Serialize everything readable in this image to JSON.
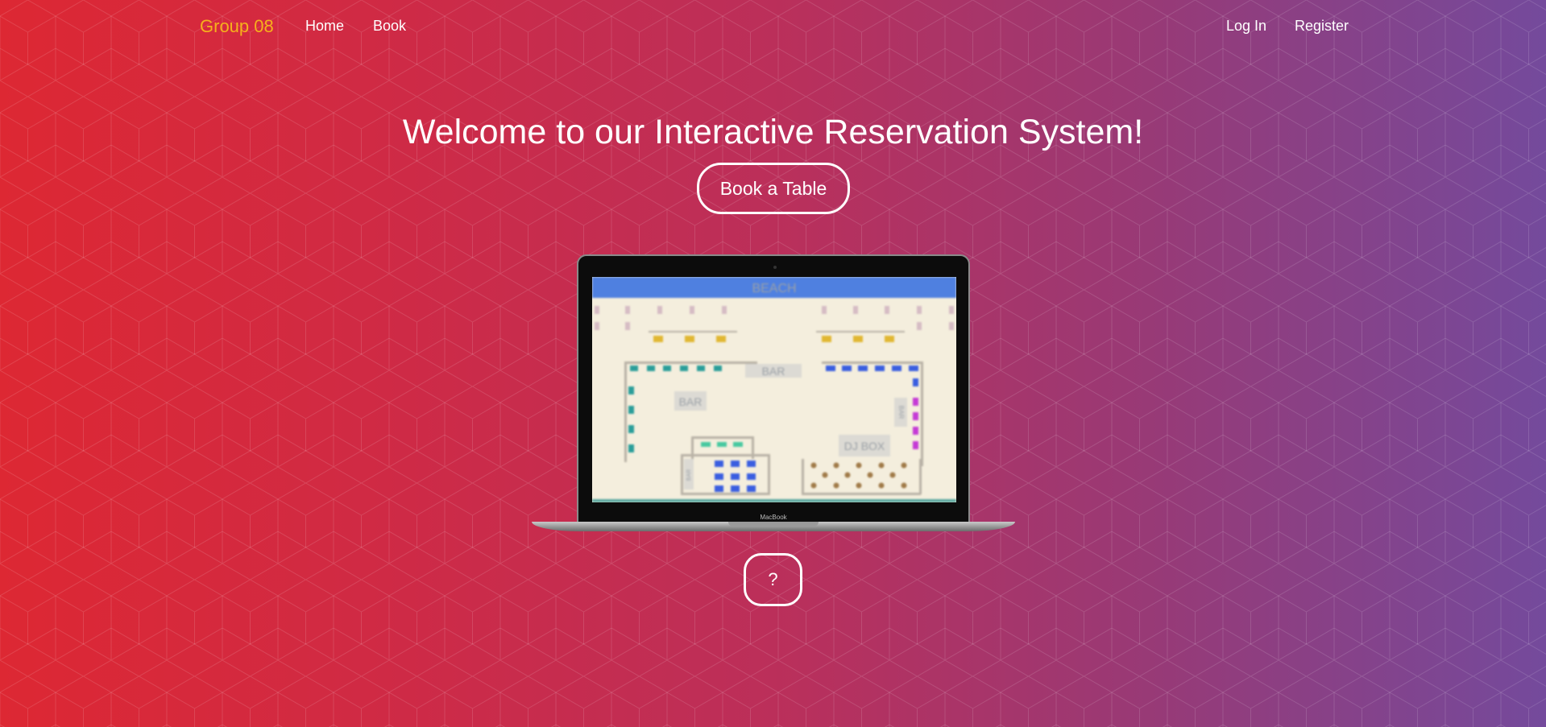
{
  "nav": {
    "brand": "Group 08",
    "links": [
      "Home",
      "Book"
    ],
    "auth": [
      "Log In",
      "Register"
    ]
  },
  "hero": {
    "title": "Welcome to our Interactive Reservation System!",
    "cta_label": "Book a Table",
    "help_label": "?"
  },
  "laptop": {
    "brand_label": "MacBook",
    "floorplan": {
      "header": "BEACH",
      "bar_top": "BAR",
      "bar_left": "BAR",
      "bar_right": "BAR",
      "bar_small": "BAR",
      "dj_box": "DJ BOX"
    }
  },
  "colors": {
    "brand": "#f6b01c",
    "gradient_left": "#dd2833",
    "gradient_right": "#744a9c",
    "floorplan_header": "#4f80e0",
    "floorplan_bg": "#f4eedd"
  },
  "icons": {
    "help": "question-mark"
  }
}
